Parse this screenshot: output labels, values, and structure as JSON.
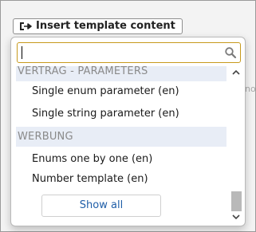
{
  "toolbar": {
    "insert_label": "Insert template content",
    "insert_icon": "insert-arrow-icon"
  },
  "background": {
    "fragment": "no"
  },
  "dropdown": {
    "search": {
      "value": "",
      "placeholder": "",
      "icon": "search-icon"
    },
    "groups": [
      {
        "label": "VERTRAG - PARAMETERS",
        "items": [
          "Single enum parameter (en)",
          "Single string parameter (en)"
        ]
      },
      {
        "label": "WERBUNG",
        "items": [
          "Enums one by one (en)",
          "Number template (en)"
        ]
      }
    ],
    "show_all_label": "Show all",
    "scroll_position": 0.9
  },
  "colors": {
    "accent": "#1f5ea8",
    "focus_border": "#c79a1d",
    "group_background": "#e8edf6"
  }
}
